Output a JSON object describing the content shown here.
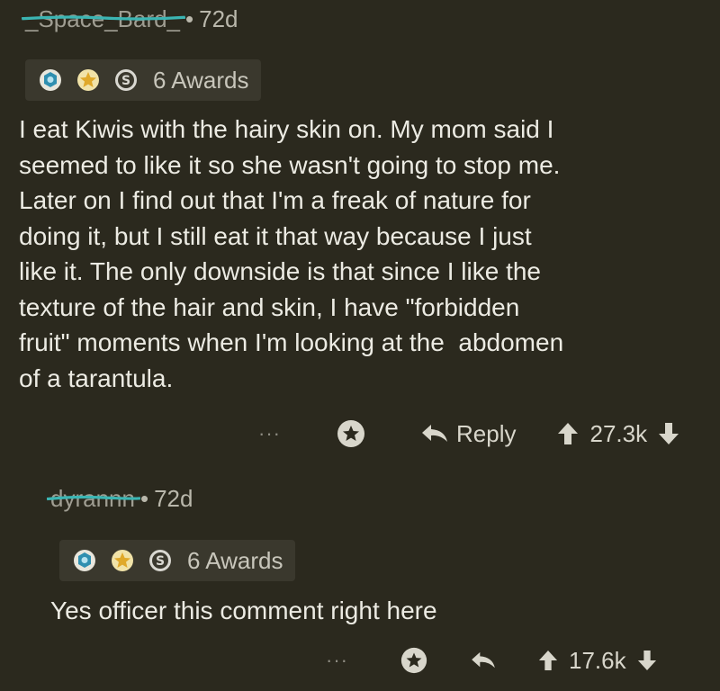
{
  "comment1": {
    "username": "_Space_Bard_",
    "age": "72d",
    "awards_label": "6 Awards",
    "body": "I eat Kiwis with the hairy skin on. My mom said I\nseemed to like it so she wasn't going to stop me.\nLater on I find out that I'm a freak of nature for\ndoing it, but I still eat it that way because I just\nlike it. The only downside is that since I like the\ntexture of the hair and skin, I have \"forbidden\nfruit\" moments when I'm looking at the  abdomen\nof a tarantula.",
    "reply_label": "Reply",
    "score": "27.3k",
    "more": "···"
  },
  "comment2": {
    "username": "dyrannn",
    "age": "72d",
    "awards_label": "6 Awards",
    "body": "Yes officer this comment right here",
    "score": "17.6k",
    "more": "···"
  },
  "separator": "•",
  "colors": {
    "background": "#2b291e",
    "scribble": "#3bb5b3",
    "award_badge_bg": "#3a382d"
  },
  "icons": [
    "award-blue-icon",
    "award-gold-icon",
    "award-silver-icon",
    "award-give-icon",
    "reply-icon",
    "upvote-icon",
    "downvote-icon",
    "more-icon"
  ]
}
